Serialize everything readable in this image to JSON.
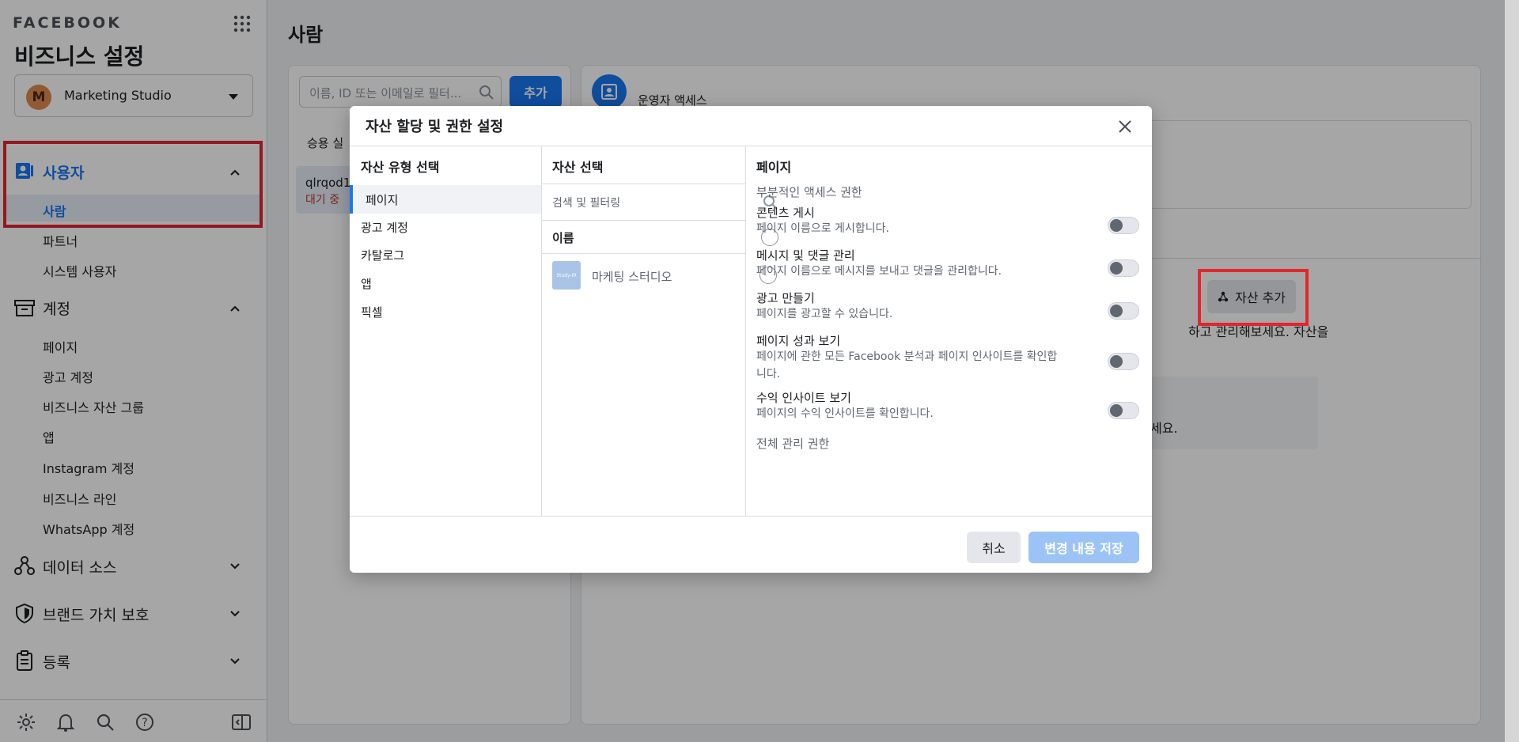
{
  "sidebar": {
    "brand": "FACEBOOK",
    "title": "비즈니스 설정",
    "business": {
      "initial": "M",
      "name": "Marketing Studio"
    },
    "users_section": {
      "label": "사용자",
      "items": [
        "사람",
        "파트너",
        "시스템 사용자"
      ]
    },
    "accounts_section": {
      "label": "계정",
      "items": [
        "페이지",
        "광고 계정",
        "비즈니스 자산 그룹",
        "앱",
        "Instagram 계정",
        "비즈니스 라인",
        "WhatsApp 계정"
      ]
    },
    "data_sources": "데이터 소스",
    "brand_safety": "브랜드 가치 보호",
    "registrations": "등록"
  },
  "main": {
    "title": "사람",
    "filter_placeholder": "이름, ID 또는 이메일로 필터...",
    "add_button": "추가",
    "list_header": "승용 실",
    "user_row": {
      "name": "qlrqod1",
      "status": "대기 중"
    },
    "person_role": "운영자 액세스",
    "add_asset_button": "자산 추가",
    "text_fragment_1": "하고 관리해보세요. 자산을",
    "text_fragment_2": "세요."
  },
  "modal": {
    "title": "자산 할당 및 권한 설정",
    "col1_header": "자산 유형 선택",
    "asset_types": [
      "페이지",
      "광고 계정",
      "카탈로그",
      "앱",
      "픽셀"
    ],
    "col2_header": "자산 선택",
    "search_placeholder": "검색 및 필터링",
    "name_header": "이름",
    "asset_item": {
      "thumb": "Study-IR",
      "name": "마케팅 스터디오"
    },
    "col3_header": "페이지",
    "partial_access": "부분적인 액세스 권한",
    "permissions": [
      {
        "title": "콘텐츠 게시",
        "desc": "페이지 이름으로 게시합니다."
      },
      {
        "title": "메시지 및 댓글 관리",
        "desc": "페이지 이름으로 메시지를 보내고 댓글을 관리합니다."
      },
      {
        "title": "광고 만들기",
        "desc": "페이지를 광고할 수 있습니다."
      },
      {
        "title": "페이지 성과 보기",
        "desc": "페이지에 관한 모든 Facebook 분석과 페이지 인사이트를 확인합니다."
      },
      {
        "title": "수익 인사이트 보기",
        "desc": "페이지의 수익 인사이트를 확인합니다."
      }
    ],
    "full_access": "전체 관리 권한",
    "cancel": "취소",
    "save": "변경 내용 저장"
  },
  "colors": {
    "accent": "#1877f2",
    "highlight_red": "#e3262d",
    "save_disabled": "#9cc3f5"
  }
}
